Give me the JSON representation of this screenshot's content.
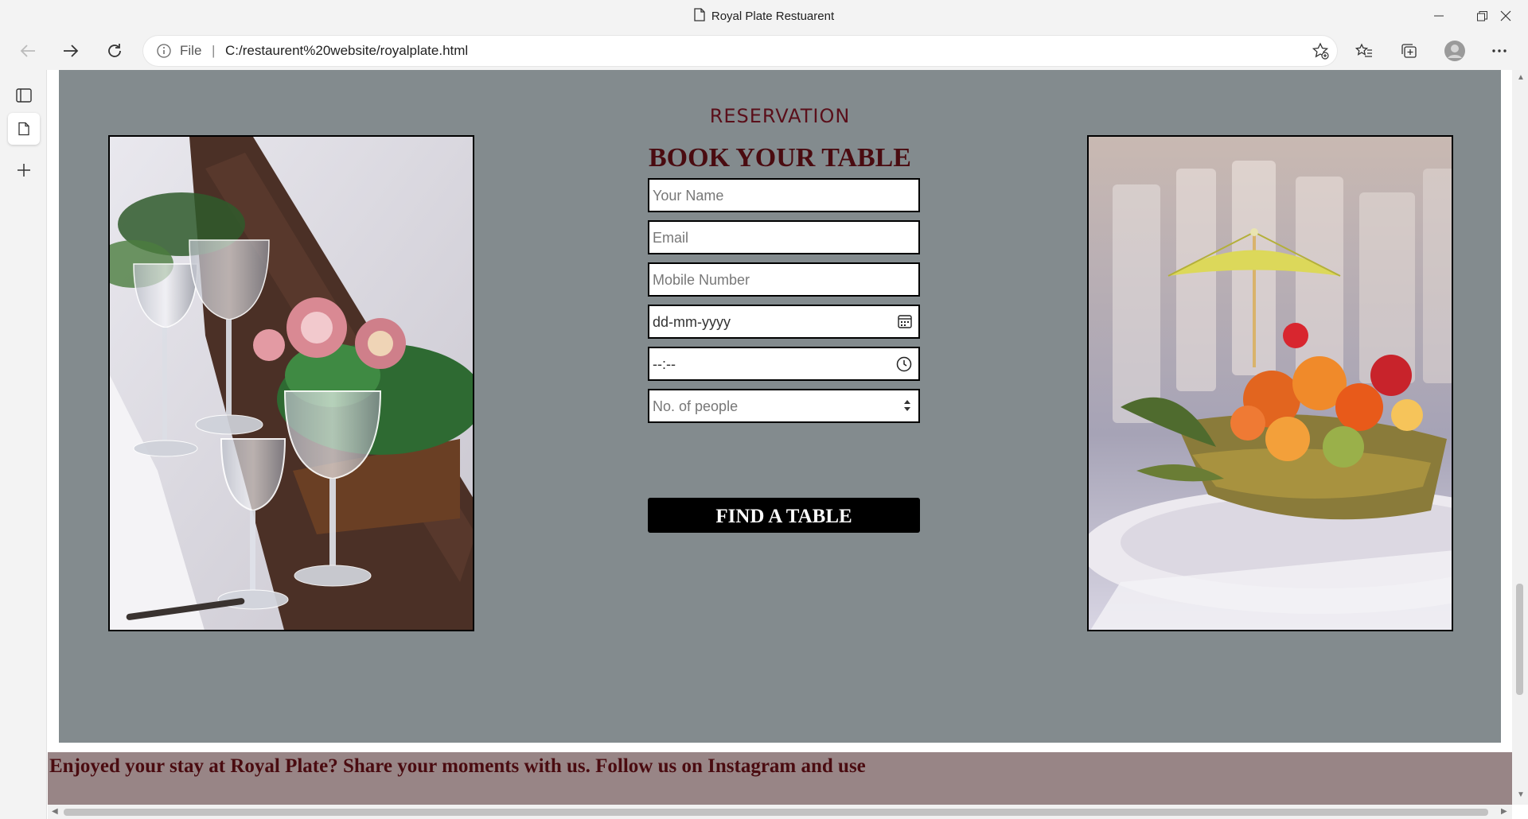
{
  "window": {
    "title": "Royal Plate Restuarent"
  },
  "address_bar": {
    "scheme_label": "File",
    "separator": "|",
    "url": "C:/restaurent%20website/royalplate.html"
  },
  "reservation": {
    "kicker": "RESERVATION",
    "headline": "BOOK YOUR TABLE",
    "fields": {
      "name_placeholder": "Your Name",
      "email_placeholder": "Email",
      "mobile_placeholder": "Mobile Number",
      "date_value": "dd-mm-yyyy",
      "time_value": "--:--",
      "people_placeholder": "No. of people"
    },
    "submit_label": "FIND A TABLE"
  },
  "footer": {
    "text": "Enjoyed your stay at Royal Plate? Share your moments with us. Follow us on Instagram and use"
  },
  "colors": {
    "reservation_bg": "#838b8e",
    "heading": "#4a0b10",
    "footer_bg": "#988586",
    "button_bg": "#000000"
  }
}
